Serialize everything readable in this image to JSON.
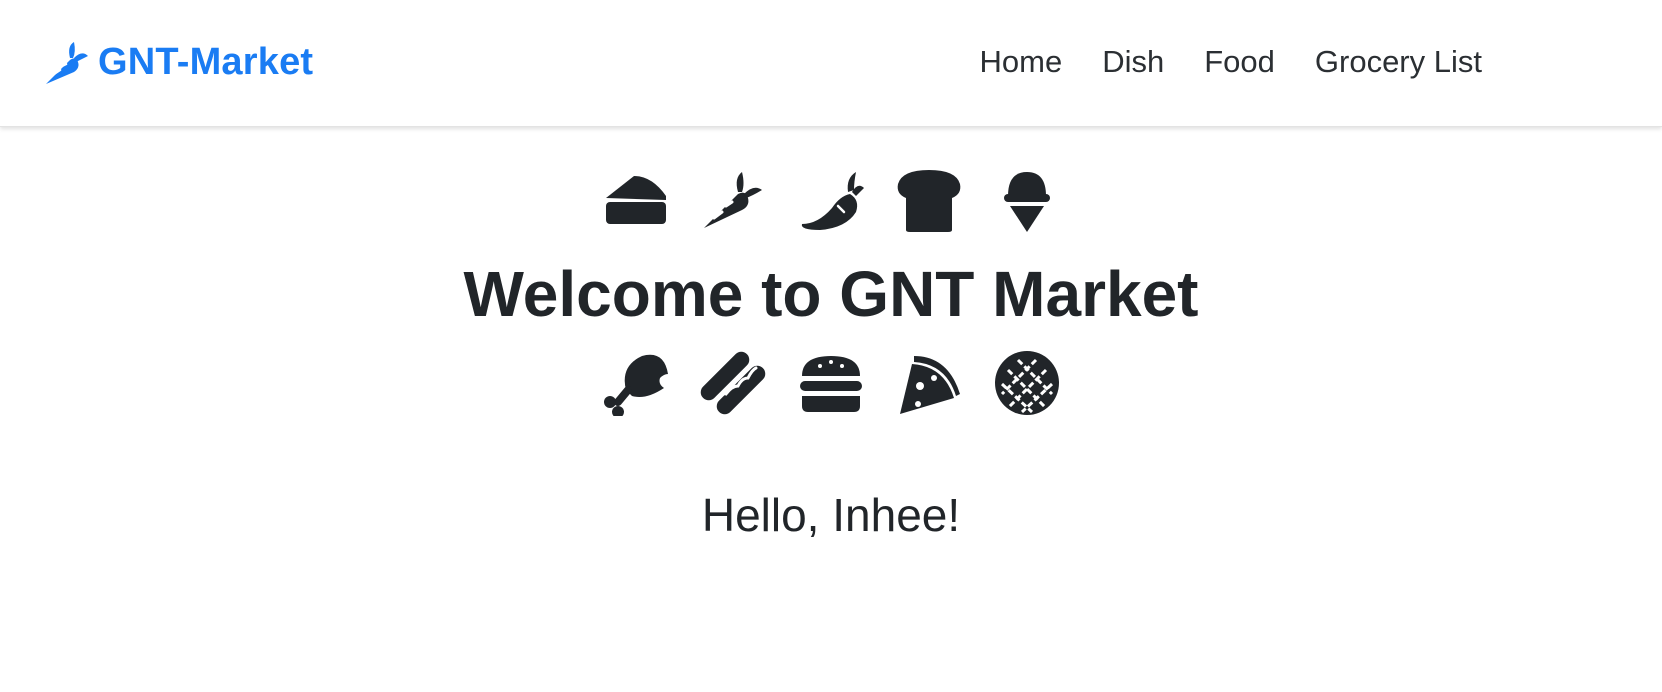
{
  "navbar": {
    "brand": {
      "name": "GNT-Market",
      "icon": "carrot-icon",
      "color": "#1a7cf3"
    },
    "links": [
      {
        "label": "Home"
      },
      {
        "label": "Dish"
      },
      {
        "label": "Food"
      },
      {
        "label": "Grocery List"
      }
    ]
  },
  "hero": {
    "top_icons": [
      "cheesecake-icon",
      "carrot-icon",
      "pepper-icon",
      "bread-icon",
      "ice-cream-icon"
    ],
    "title": "Welcome to GNT Market",
    "bottom_icons": [
      "drumstick-icon",
      "hotdog-icon",
      "hamburger-icon",
      "pizza-slice-icon",
      "pie-icon"
    ]
  },
  "greeting": "Hello, Inhee!",
  "colors": {
    "brand": "#1a7cf3",
    "text": "#212529",
    "icon": "#212529"
  }
}
